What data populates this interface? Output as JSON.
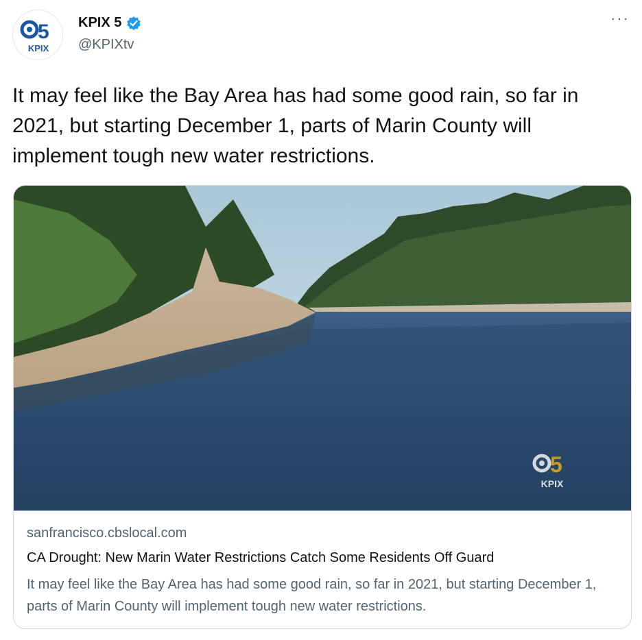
{
  "account": {
    "display_name": "KPIX 5",
    "handle": "@KPIXtv",
    "verified": true,
    "avatar_logo_number": "5",
    "avatar_logo_text": "KPIX"
  },
  "menu": {
    "more_icon": "ellipsis-icon",
    "more_label": "···"
  },
  "tweet": {
    "text": "It may feel like the Bay Area has had some good rain, so far in 2021, but starting December 1, parts of Marin County will implement tough new water restrictions."
  },
  "card": {
    "domain": "sanfrancisco.cbslocal.com",
    "title": "CA Drought: New Marin Water Restrictions Catch Some Residents Off Guard",
    "description": "It may feel like the Bay Area has had some good rain, so far in 2021, but starting December 1, parts of Marin County will implement tough new water restrictions.",
    "watermark_number": "5",
    "watermark_text": "KPIX"
  },
  "colors": {
    "verified_badge": "#1d9bf0",
    "text_primary": "#0f1419",
    "text_secondary": "#536471",
    "border": "#cfd9de",
    "logo_blue": "#1b57a6",
    "watermark_gold": "#d9a520"
  }
}
